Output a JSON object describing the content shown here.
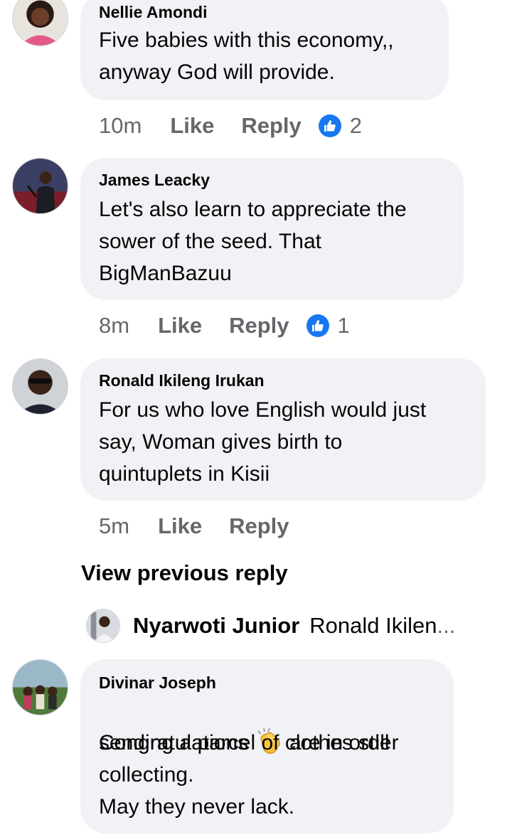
{
  "comments": [
    {
      "author": "Nellie Amondi",
      "lines": [
        "Five babies with this economy,,",
        "anyway God will provide."
      ],
      "time": "10m",
      "like_label": "Like",
      "reply_label": "Reply",
      "reaction_count": "2",
      "avatar_icon": "user-avatar-photo"
    },
    {
      "author": "James Leacky",
      "lines": [
        "Let's also learn to appreciate the",
        "sower of the seed. That",
        "BigManBazuu"
      ],
      "time": "8m",
      "like_label": "Like",
      "reply_label": "Reply",
      "reaction_count": "1",
      "avatar_icon": "user-avatar-photo"
    },
    {
      "author": "Ronald Ikileng Irukan",
      "lines": [
        "For us who love English would just",
        "say, Woman gives birth to",
        "quintuplets in Kisii"
      ],
      "time": "5m",
      "like_label": "Like",
      "reply_label": "Reply",
      "avatar_icon": "user-avatar-photo"
    },
    {
      "author": "Divinar Joseph",
      "line1_before": "Congratulations",
      "line1_after": "are in order",
      "lines_rest": [
        "sending a parcel of clothes still",
        "collecting.",
        "May they never lack."
      ],
      "emoji": "clapping-hands-icon",
      "avatar_icon": "user-avatar-photo"
    }
  ],
  "view_previous": "View previous reply",
  "reply_preview": {
    "author": "Nyarwoti Junior",
    "text": "Ronald Ikilen",
    "ellipsis": "..."
  },
  "colors": {
    "bubble": "#f0f2f5",
    "meta_text": "#65676b",
    "like_blue": "#1877f2"
  }
}
